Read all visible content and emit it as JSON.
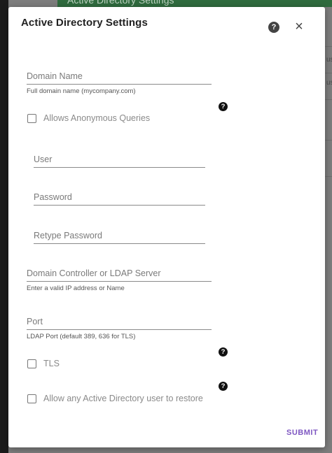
{
  "background": {
    "header_text": "Active Directory Settings",
    "cell_fragments": [
      "us",
      "us"
    ]
  },
  "dialog": {
    "title": "Active Directory Settings",
    "help_glyph": "?",
    "close_glyph": "×"
  },
  "fields": {
    "domain_name": {
      "label": "Domain Name",
      "hint": "Full domain name (mycompany.com)"
    },
    "allow_anonymous": {
      "label": "Allows Anonymous Queries",
      "checked": false
    },
    "user": {
      "label": "User"
    },
    "password": {
      "label": "Password"
    },
    "retype_password": {
      "label": "Retype Password"
    },
    "domain_controller": {
      "label": "Domain Controller or LDAP Server",
      "hint": "Enter a valid IP address or Name"
    },
    "port": {
      "label": "Port",
      "hint": "LDAP Port (default 389, 636 for TLS)"
    },
    "tls": {
      "label": "TLS",
      "checked": false
    },
    "allow_any_user": {
      "label": "Allow any Active Directory user to restore",
      "checked": false
    }
  },
  "help_glyph": "?",
  "actions": {
    "submit_label": "SUBMIT"
  },
  "colors": {
    "accent": "#7e57c2",
    "header_bar": "#2f6b3e"
  }
}
